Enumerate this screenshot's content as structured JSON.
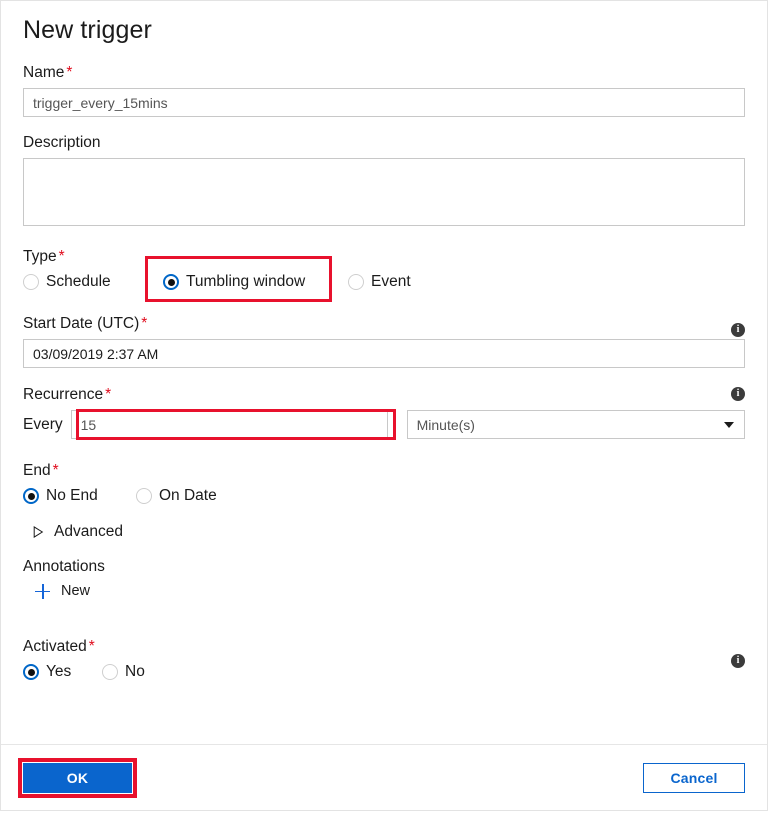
{
  "dialog": {
    "title": "New trigger"
  },
  "fields": {
    "name": {
      "label": "Name",
      "required": "*",
      "value": "trigger_every_15mins"
    },
    "description": {
      "label": "Description",
      "value": "",
      "placeholder": ""
    },
    "type": {
      "label": "Type",
      "required": "*",
      "options": [
        {
          "label": "Schedule",
          "checked": false
        },
        {
          "label": "Tumbling window",
          "checked": true
        },
        {
          "label": "Event",
          "checked": false
        }
      ],
      "selected": "Tumbling window"
    },
    "start_date": {
      "label": "Start Date (UTC)",
      "required": "*",
      "value": "03/09/2019 2:37 AM",
      "info_icon": "info-icon"
    },
    "recurrence": {
      "label": "Recurrence",
      "required": "*",
      "every_label": "Every",
      "every_value": "15",
      "unit_value": "Minute(s)",
      "unit_options": [
        "Minute(s)",
        "Hour(s)",
        "Day(s)",
        "Week(s)",
        "Month(s)"
      ],
      "info_icon": "info-icon",
      "caret_icon": "chevron-down-icon"
    },
    "end": {
      "label": "End",
      "required": "*",
      "options": [
        {
          "label": "No End",
          "checked": true
        },
        {
          "label": "On Date",
          "checked": false
        }
      ],
      "selected": "No End"
    },
    "advanced": {
      "label": "Advanced",
      "expander_icon": "triangle-right-icon",
      "expanded": false
    },
    "annotations": {
      "label": "Annotations",
      "new_label": "New",
      "new_icon": "plus-icon"
    },
    "activated": {
      "label": "Activated",
      "required": "*",
      "options": [
        {
          "label": "Yes",
          "checked": true
        },
        {
          "label": "No",
          "checked": false
        }
      ],
      "selected": "Yes",
      "info_icon": "info-icon"
    }
  },
  "footer": {
    "ok_label": "OK",
    "cancel_label": "Cancel"
  },
  "colors": {
    "accent_blue": "#0a65cd",
    "highlight_red": "#e8112d",
    "required_red": "#e00b1c",
    "radio_selected_ring": "#0067c8",
    "border_gray": "#c8c8c8"
  },
  "info_glyph": "i"
}
